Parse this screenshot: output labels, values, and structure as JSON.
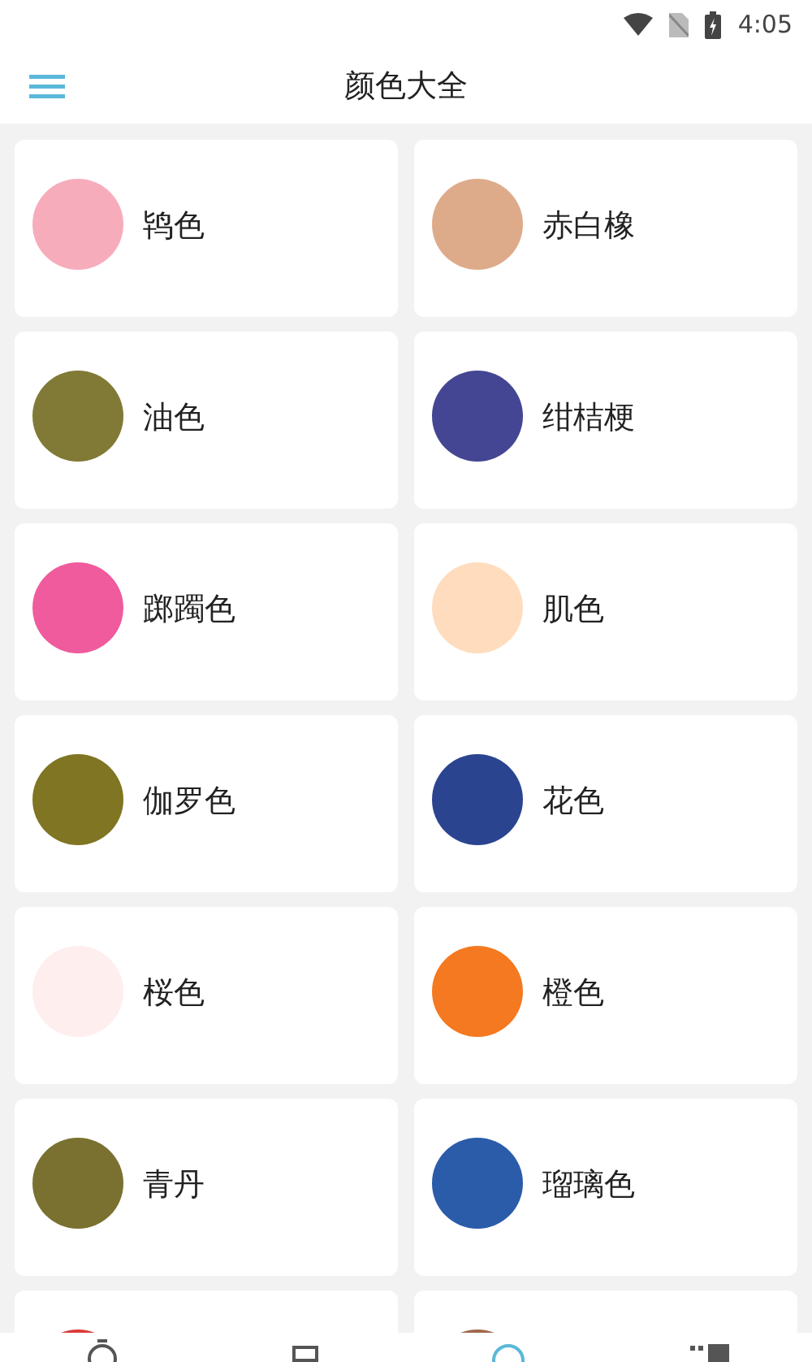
{
  "status_bar": {
    "time": "4:05"
  },
  "app_bar": {
    "title": "颜色大全"
  },
  "colors": [
    {
      "name": "鸨色",
      "color": "#f7acbc"
    },
    {
      "name": "赤白橡",
      "color": "#deab8a"
    },
    {
      "name": "油色",
      "color": "#817936"
    },
    {
      "name": "绀桔梗",
      "color": "#444693"
    },
    {
      "name": "踯躅色",
      "color": "#ef5b9c"
    },
    {
      "name": "肌色",
      "color": "#fedcbd"
    },
    {
      "name": "伽罗色",
      "color": "#7f7522"
    },
    {
      "name": "花色",
      "color": "#2b4490"
    },
    {
      "name": "桜色",
      "color": "#feeeed"
    },
    {
      "name": "橙色",
      "color": "#f47920"
    },
    {
      "name": "青丹",
      "color": "#7a7130"
    },
    {
      "name": "瑠璃色",
      "color": "#2a5caa"
    },
    {
      "color": "#d93a3a"
    },
    {
      "color": "#a0684a"
    }
  ],
  "bottom_nav": [
    {
      "kind": "timer",
      "selected": false
    },
    {
      "kind": "square",
      "selected": false
    },
    {
      "kind": "palette",
      "selected": true
    },
    {
      "kind": "grid",
      "selected": false
    }
  ]
}
